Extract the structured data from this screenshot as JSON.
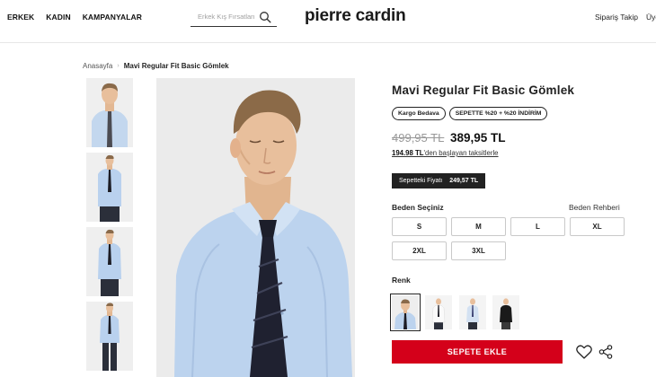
{
  "header": {
    "nav": [
      "ERKEK",
      "KADIN",
      "KAMPANYALAR"
    ],
    "search_placeholder": "Erkek Kış Fırsatları",
    "search_icon": "search-icon",
    "logo": "pierre cardin",
    "order_track": "Sipariş Takip",
    "user_link": "Üye"
  },
  "breadcrumb": {
    "home": "Anasayfa",
    "separator": "›",
    "current": "Mavi Regular Fit Basic Gömlek"
  },
  "product": {
    "title": "Mavi Regular Fit Basic Gömlek",
    "badges": [
      "Kargo Bedava",
      "SEPETTE %20 + %20 İNDİRİM"
    ],
    "old_price": "499,95 TL",
    "new_price": "389,95 TL",
    "installment_amount": "194.98 TL",
    "installment_text": "'den başlayan taksitlerle",
    "cart_price_label": "Sepetteki Fiyatı",
    "cart_price_value": "249,57 TL",
    "size_label": "Beden Seçiniz",
    "size_guide": "Beden Rehberi",
    "sizes": [
      "S",
      "M",
      "L",
      "XL",
      "2XL",
      "3XL"
    ],
    "color_label": "Renk",
    "add_to_cart": "SEPETE EKLE"
  },
  "colors": {
    "accent_red": "#d4001a",
    "shirt_blue": "#bcd3ee",
    "dark": "#222222"
  }
}
